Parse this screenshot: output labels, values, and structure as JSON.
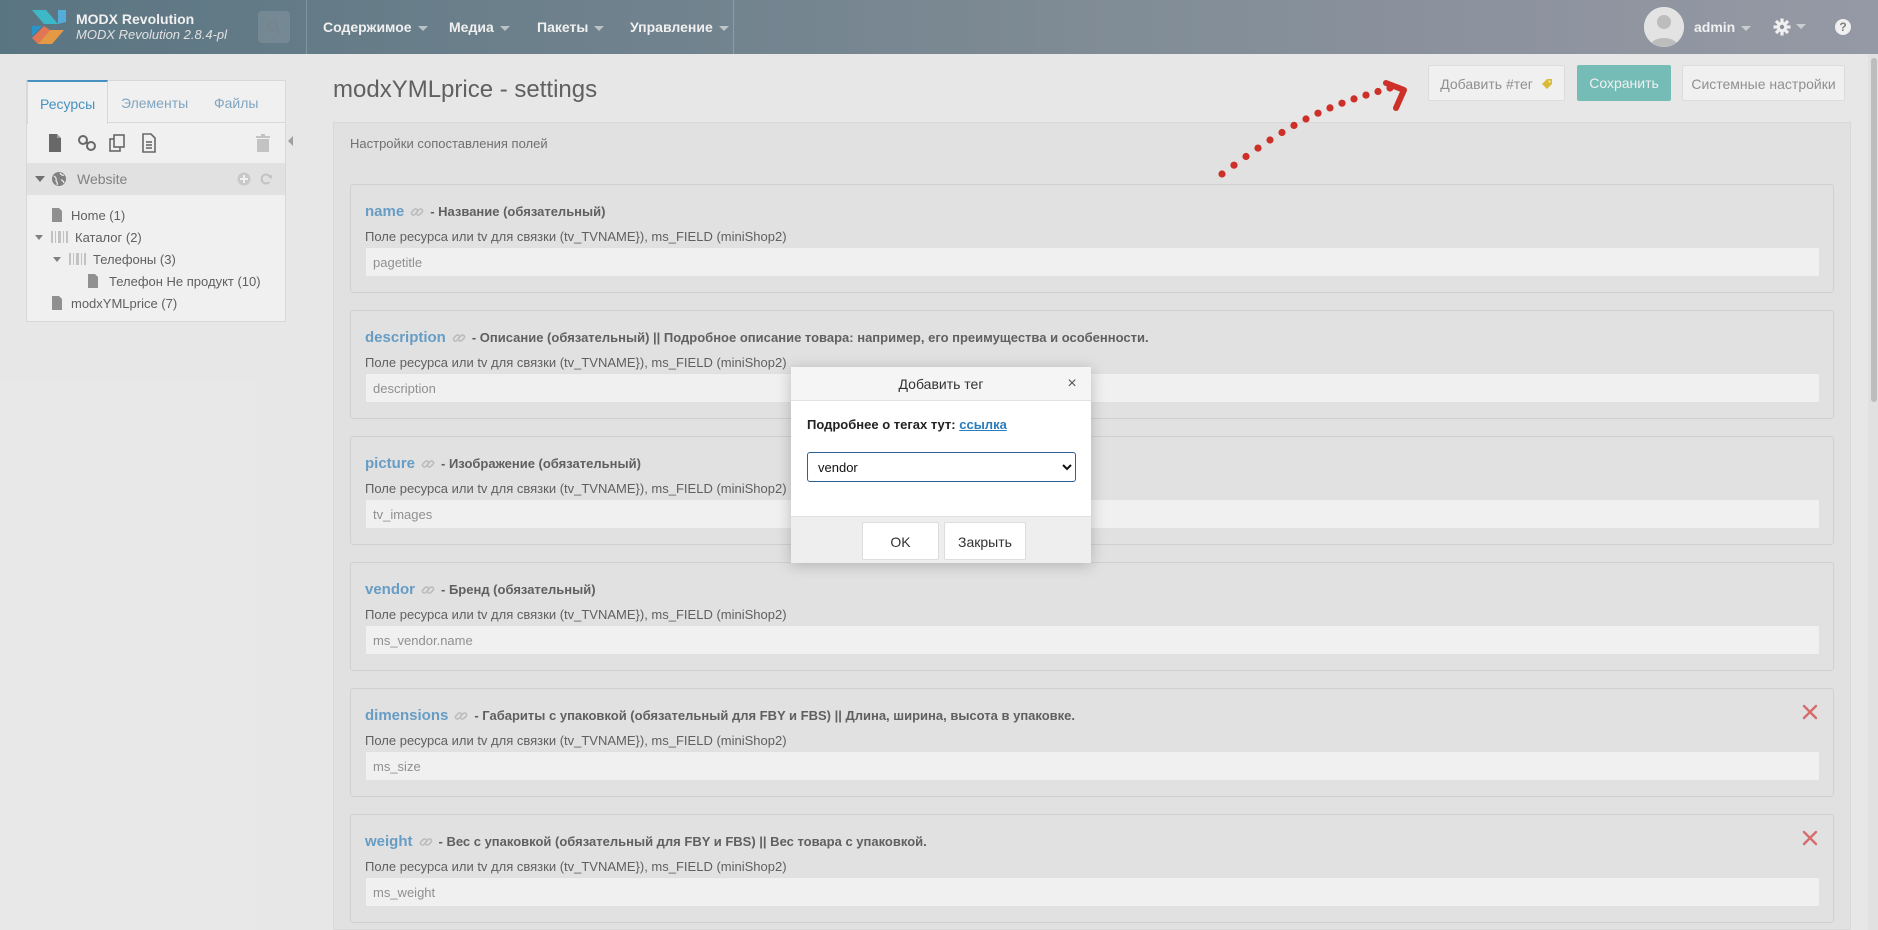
{
  "topbar": {
    "brand_name": "MODX Revolution",
    "brand_version": "MODX Revolution 2.8.4-pl",
    "nav": [
      "Содержимое",
      "Медиа",
      "Пакеты",
      "Управление"
    ],
    "user": "admin",
    "help": "?"
  },
  "sidebar": {
    "tabs": [
      "Ресурсы",
      "Элементы",
      "Файлы"
    ],
    "root": "Website",
    "tree": [
      {
        "label": "Home (1)"
      },
      {
        "label": "Каталог (2)"
      },
      {
        "label": "Телефоны (3)"
      },
      {
        "label": "Телефон Не продукт (10)"
      },
      {
        "label": "modxYMLprice (7)"
      }
    ]
  },
  "main": {
    "title": "modxYMLprice - settings",
    "add_tag_label": "Добавить #тег",
    "save_label": "Сохранить",
    "system_settings_label": "Системные настройки",
    "panel_header": "Настройки сопоставления полей",
    "hint": "Поле ресурса или tv для связки (tv_TVNAME}), ms_FIELD (miniShop2)",
    "fields": [
      {
        "name": "name",
        "desc": "- Название (обязательный)",
        "value": "pagetitle",
        "removable": false
      },
      {
        "name": "description",
        "desc": "- Описание (обязательный) || Подробное описание товара: например, его преимущества и особенности.",
        "value": "description",
        "removable": false
      },
      {
        "name": "picture",
        "desc": "- Изображение (обязательный)",
        "value": "tv_images",
        "removable": false
      },
      {
        "name": "vendor",
        "desc": "- Бренд (обязательный)",
        "value": "ms_vendor.name",
        "removable": false
      },
      {
        "name": "dimensions",
        "desc": "- Габариты с упаковкой (обязательный для FBY и FBS) || Длина, ширина, высота в упаковке.",
        "value": "ms_size",
        "removable": true
      },
      {
        "name": "weight",
        "desc": "- Вес с упаковкой (обязательный для FBY и FBS) || Вес товара с упаковкой.",
        "value": "ms_weight",
        "removable": true
      }
    ]
  },
  "modal": {
    "title": "Добавить тег",
    "info_prefix": "Подробнее о тегах тут:",
    "info_link": "ссылка",
    "selected": "vendor",
    "ok_label": "OK",
    "close_label": "Закрыть"
  },
  "colors": {
    "accent": "#7ec8c2",
    "link": "#6ea7d1",
    "remove": "#e57373",
    "arrow": "#d9342b"
  }
}
